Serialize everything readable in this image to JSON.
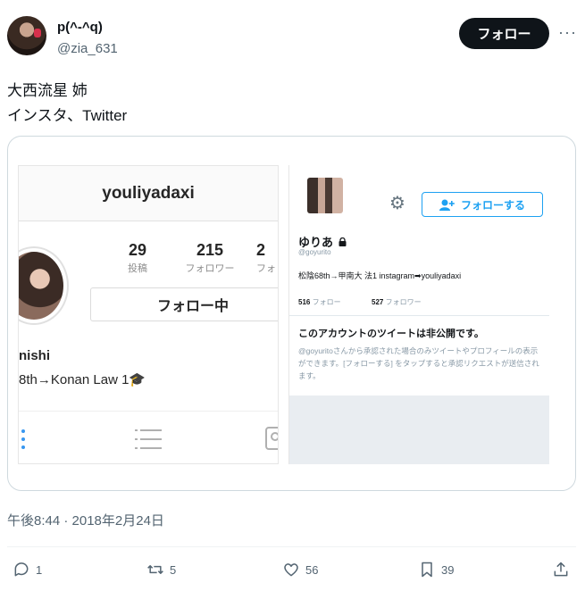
{
  "author": {
    "display_name": "p(^-^q)",
    "handle": "@zia_631"
  },
  "header": {
    "follow_label": "フォロー",
    "more_label": "···"
  },
  "tweet": {
    "line1": "大西流星 姉",
    "line2": "インスタ、Twitter",
    "timestamp": "午後8:44 · 2018年2月24日"
  },
  "instagram": {
    "username": "youliyadaxi",
    "stats": [
      {
        "num": "29",
        "label": "投稿"
      },
      {
        "num": "215",
        "label": "フォロワー"
      },
      {
        "num": "2",
        "label": "フォ"
      }
    ],
    "follow_button": "フォロー中",
    "name": "nishi",
    "bio": "8th→Konan Law 1🎓"
  },
  "twitter_profile": {
    "follow_button": "フォローする",
    "name": "ゆりあ",
    "handle": "@goyurito",
    "bio": "松陰68th→甲南大 法1 instagram➡youliyadaxi",
    "following_count": "516",
    "following_label": "フォロー",
    "followers_count": "527",
    "followers_label": "フォロワー",
    "private_title": "このアカウントのツイートは非公開です。",
    "private_text": "@goyuritoさんから承認された場合のみツイートやプロフィールの表示ができます。[フォローする] をタップすると承認リクエストが送信されます。"
  },
  "actions": {
    "replies": "1",
    "retweets": "5",
    "likes": "56",
    "bookmarks": "39"
  },
  "colors": {
    "follow_bg": "#0f1419",
    "twitter_blue": "#1da1f2",
    "secondary_text": "#536471"
  }
}
